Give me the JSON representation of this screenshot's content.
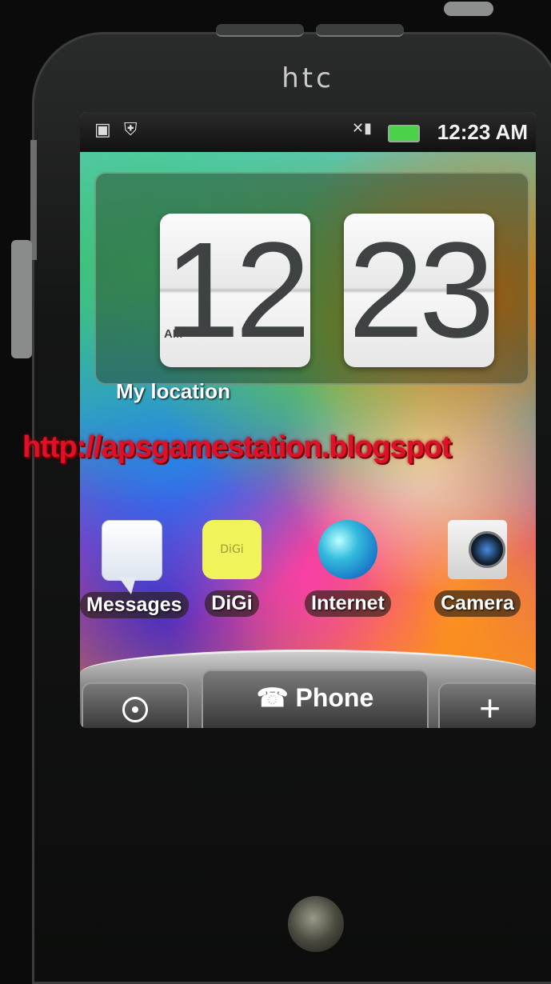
{
  "device": {
    "brand": "htc"
  },
  "status_bar": {
    "time": "12:23 AM"
  },
  "clock_widget": {
    "hour": "12",
    "minute": "23",
    "ampm": "AM",
    "location": "My location"
  },
  "watermark": {
    "text": "http://apsgamestation.blogspot"
  },
  "apps": [
    {
      "label": "Messages",
      "icon": "messages-icon"
    },
    {
      "label": "DiGi",
      "icon": "digi-icon",
      "icon_text": "DiGi"
    },
    {
      "label": "Internet",
      "icon": "globe-icon"
    },
    {
      "label": "Camera",
      "icon": "camera-icon"
    }
  ],
  "dock": {
    "phone_label": "Phone",
    "phone_icon": "☎",
    "plus_icon": "+"
  }
}
